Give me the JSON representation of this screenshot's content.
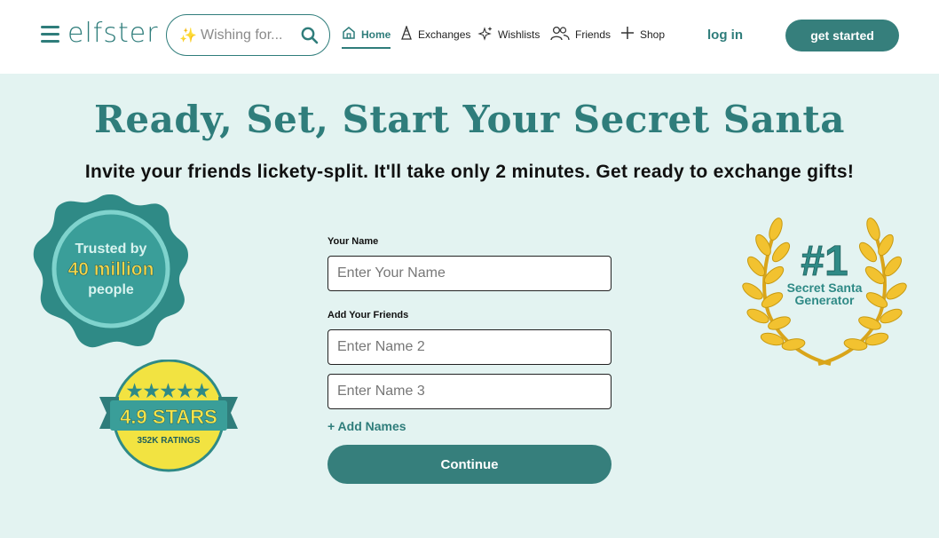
{
  "header": {
    "logo": "elfster",
    "search": {
      "placeholder": "Wishing for..."
    },
    "nav": [
      {
        "label": "Home",
        "icon": "home-icon",
        "active": true
      },
      {
        "label": "Exchanges",
        "icon": "gift-cone-icon",
        "active": false
      },
      {
        "label": "Wishlists",
        "icon": "sparkle-icon",
        "active": false
      },
      {
        "label": "Friends",
        "icon": "friends-icon",
        "active": false
      },
      {
        "label": "Shop",
        "icon": "plus-icon",
        "active": false
      }
    ],
    "login_label": "log in",
    "get_started_label": "get started"
  },
  "hero": {
    "title": "Ready, Set, Start Your Secret Santa",
    "subtitle": "Invite your friends lickety-split. It'll take only 2 minutes. Get ready to exchange gifts!"
  },
  "form": {
    "your_name_label": "Your Name",
    "your_name_placeholder": "Enter Your Name",
    "add_friends_label": "Add Your Friends",
    "friend_placeholders": [
      "Enter Name 2",
      "Enter Name 3"
    ],
    "add_names_label": "+ Add Names",
    "continue_label": "Continue"
  },
  "badges": {
    "trusted": {
      "line1": "Trusted by",
      "line2": "40 million",
      "line3": "people"
    },
    "stars": {
      "rating": "4.9 STARS",
      "ratings_count": "352K RATINGS",
      "stars": 5
    },
    "ranking": {
      "rank": "#1",
      "line1": "Secret Santa",
      "line2": "Generator"
    }
  },
  "colors": {
    "brand": "#2f7d7b",
    "button": "#367f7c",
    "background": "#e3f3f1",
    "gold": "#f2c230"
  }
}
